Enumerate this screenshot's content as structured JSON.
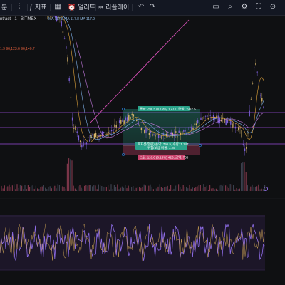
{
  "toolbar": {
    "interval": "분",
    "indicators_label": "지표",
    "alert_label": "얼러트",
    "replay_label": "리플레이"
  },
  "symbol": {
    "text": "ntract · 1 · BITMEX"
  },
  "indicators": {
    "values_row1": "MA 117.5  MA 117.8  MA 117.9",
    "values_row2": "1.9  96,123.6  96,140.7",
    "values_row2_tail": "96,140.7"
  },
  "position_tool": {
    "target_label": "목표: 798.5 (0.19%) 1,417, 금액: 1912.5",
    "entry_label": "포지션(열린) 손익: 796.5, 수량: 1.147",
    "entry_sub": "위험/보상 비율: 1.25",
    "stop_label": "스탑: 116.6 (0.15%) 426, 금액: 755"
  },
  "colors": {
    "background": "#0f1012",
    "candle_up": "#d6b46a",
    "candle_down": "#7c5fd6",
    "horizontal_line": "#9a4dd8",
    "trend_line": "#d44fb4",
    "target_zone": "#2aa38a",
    "stop_zone": "#c9416b",
    "oscillator_purple": "#8f6de8",
    "oscillator_gold": "#c9a052"
  },
  "icons": [
    "chart-type-icon",
    "indicators-icon",
    "layout-icon",
    "alert-icon",
    "replay-icon",
    "undo-icon",
    "redo-icon",
    "settings-icon",
    "fullscreen-icon",
    "camera-icon"
  ]
}
